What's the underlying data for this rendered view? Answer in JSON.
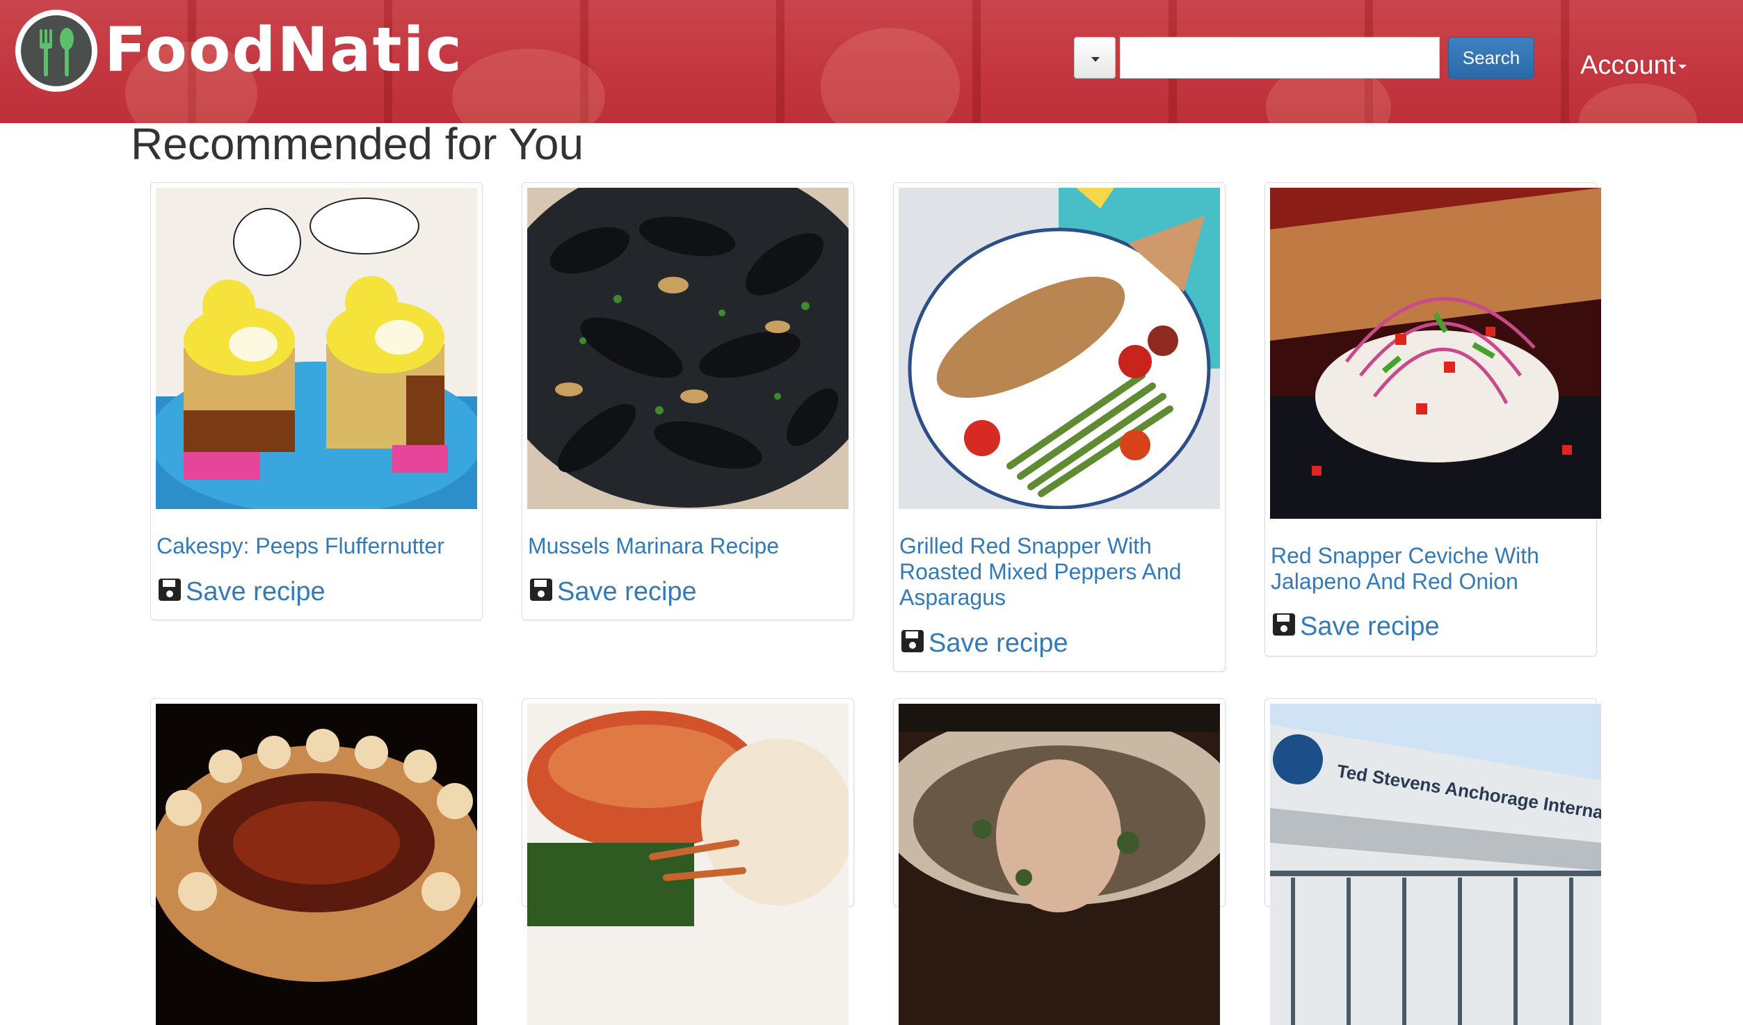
{
  "brand": {
    "name": "FoodNatic"
  },
  "header": {
    "search_placeholder": "",
    "search_value": "",
    "search_button": "Search",
    "account_label": "Account"
  },
  "main": {
    "heading": "Recommended for You",
    "save_label": "Save recipe",
    "recipes": [
      {
        "title": "Cakespy: Peeps Fluffernutter"
      },
      {
        "title": "Mussels Marinara Recipe"
      },
      {
        "title": "Grilled Red Snapper With Roasted Mixed Peppers And Asparagus"
      },
      {
        "title": "Red Snapper Ceviche With Jalapeno And Red Onion"
      },
      {
        "title": ""
      },
      {
        "title": ""
      },
      {
        "title": ""
      },
      {
        "title": ""
      }
    ],
    "image_signage_text": "Ted Stevens Anchorage International"
  },
  "colors": {
    "header_red": "#c43740",
    "link_blue": "#337ab7",
    "search_button_blue": "#2f6fae"
  },
  "icons": [
    "logo-fork-spoon-icon",
    "caret-down-icon",
    "save-disk-icon"
  ]
}
